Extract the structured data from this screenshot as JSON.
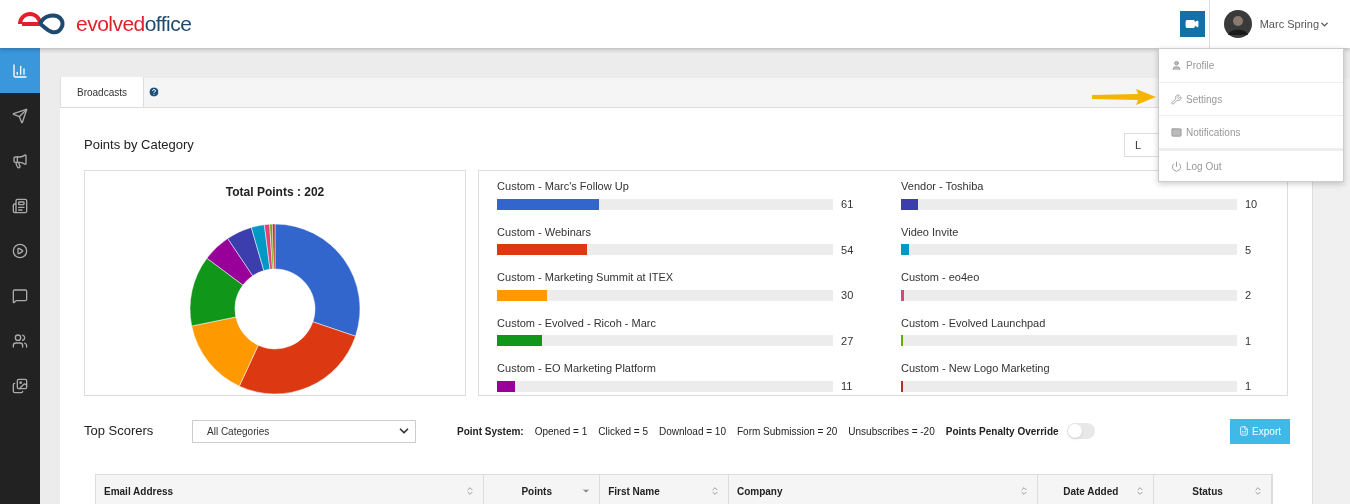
{
  "header": {
    "logo": {
      "part1": "evolved",
      "part2": "office"
    },
    "user": {
      "name": "Marc Spring"
    }
  },
  "user_menu": {
    "items": [
      {
        "label": "Profile",
        "kind": "profile"
      },
      {
        "label": "Settings",
        "kind": "settings"
      },
      {
        "label": "Notifications",
        "kind": "notifications"
      },
      {
        "label": "Log Out",
        "kind": "logout"
      }
    ]
  },
  "sidebar": {
    "items": [
      {
        "kind": "chart",
        "selected": true
      },
      {
        "kind": "send",
        "selected": false
      },
      {
        "kind": "megaphone",
        "selected": false
      },
      {
        "kind": "newspaper",
        "selected": false
      },
      {
        "kind": "play",
        "selected": false
      },
      {
        "kind": "chat",
        "selected": false
      },
      {
        "kind": "users",
        "selected": false
      },
      {
        "kind": "images",
        "selected": false
      }
    ]
  },
  "tabs": [
    {
      "label": "Broadcasts",
      "selected": true
    }
  ],
  "points_by_category": {
    "title": "Points by Category",
    "button": "L",
    "chart_data": {
      "type": "donut",
      "title": "Total Points : 202",
      "values": [
        30.2,
        26.7,
        14.9,
        13.4,
        5.4,
        4.9,
        2.5,
        1.0,
        0.5,
        0.5
      ]
    },
    "categories": [
      {
        "label": "Custom - Marc's Follow Up",
        "value": "61",
        "level": 0.302,
        "color": "#3366cc"
      },
      {
        "label": "Custom - Webinars",
        "value": "54",
        "level": 0.267,
        "color": "#dc3912"
      },
      {
        "label": "Custom - Marketing Summit at ITEX",
        "value": "30",
        "level": 0.149,
        "color": "#ff9900"
      },
      {
        "label": "Custom - Evolved - Ricoh - Marc",
        "value": "27",
        "level": 0.134,
        "color": "#109618"
      },
      {
        "label": "Custom - EO Marketing Platform",
        "value": "11",
        "level": 0.054,
        "color": "#990099"
      },
      {
        "label": "Vendor - Toshiba",
        "value": "10",
        "level": 0.05,
        "color": "#3b3eac"
      },
      {
        "label": "Video Invite",
        "value": "5",
        "level": 0.025,
        "color": "#0099c6"
      },
      {
        "label": "Custom - eo4eo",
        "value": "2",
        "level": 0.01,
        "color": "#dd4477"
      },
      {
        "label": "Custom - Evolved Launchpad",
        "value": "1",
        "level": 0.005,
        "color": "#66aa00"
      },
      {
        "label": "Custom - New Logo Marketing",
        "value": "1",
        "level": 0.005,
        "color": "#b82e2e"
      }
    ]
  },
  "top_scorers": {
    "title": "Top Scorers",
    "filter": "All Categories",
    "point_system_label": "Point System:",
    "point_system": [
      "Opened = 1",
      "Clicked = 5",
      "Download = 10",
      "Form Submission = 20",
      "Unsubscribes = -20"
    ],
    "penalty_override": {
      "label": "Points Penalty Override",
      "on": false
    },
    "export_button": "Export",
    "columns": [
      {
        "label": "Email Address",
        "sorted": false
      },
      {
        "label": "Points",
        "sorted": true
      },
      {
        "label": "First Name",
        "sorted": false
      },
      {
        "label": "Company",
        "sorted": false
      },
      {
        "label": "Date Added",
        "sorted": false
      },
      {
        "label": "Status",
        "sorted": false
      }
    ]
  }
}
